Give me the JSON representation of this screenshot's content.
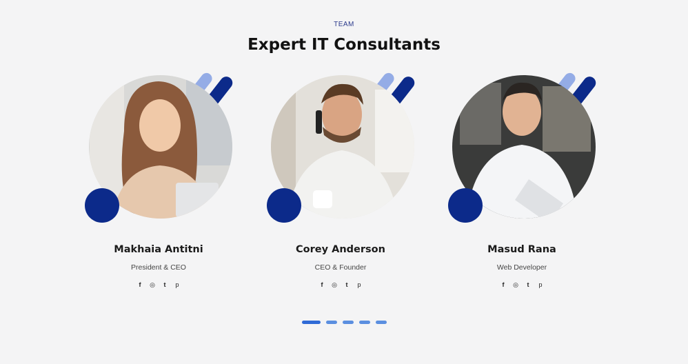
{
  "section": {
    "eyebrow": "TEAM",
    "title": "Expert IT Consultants"
  },
  "members": [
    {
      "name": "Makhaia Antitni",
      "role": "President & CEO",
      "social": [
        "facebook-icon",
        "instagram-icon",
        "twitter-icon",
        "pinterest-icon"
      ]
    },
    {
      "name": "Corey Anderson",
      "role": "CEO & Founder",
      "social": [
        "facebook-icon",
        "instagram-icon",
        "twitter-icon",
        "pinterest-icon"
      ]
    },
    {
      "name": "Masud Rana",
      "role": "Web Developer",
      "social": [
        "facebook-icon",
        "instagram-icon",
        "twitter-icon",
        "pinterest-icon"
      ]
    }
  ],
  "social_glyphs": {
    "facebook": "f",
    "instagram": "◎",
    "twitter": "t",
    "pinterest": "p"
  },
  "carousel": {
    "total_dots": 5,
    "active_index": 0
  },
  "colors": {
    "accent_dark": "#0c2a8a",
    "accent_light": "#94ace6",
    "dot_active": "#2f6ad6",
    "dot": "#5b8fe0",
    "background": "#f4f4f5"
  }
}
